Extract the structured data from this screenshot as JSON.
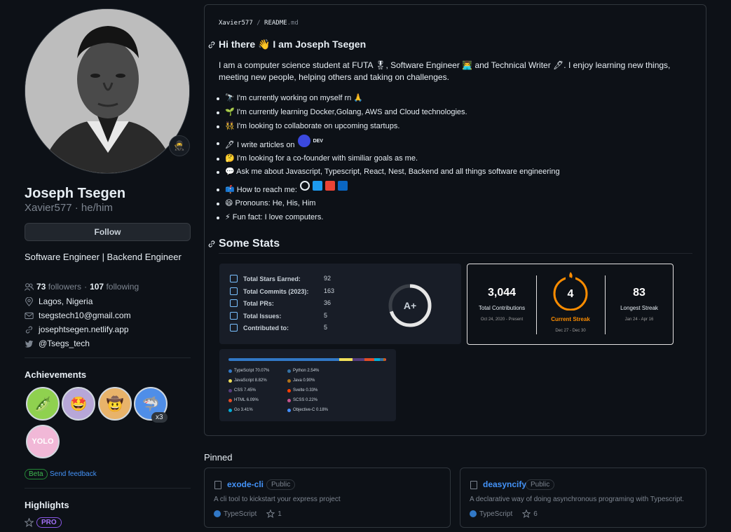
{
  "profile": {
    "name": "Joseph Tsegen",
    "login": "Xavier577",
    "pronouns": "he/him",
    "status_emoji": "🥷",
    "follow_label": "Follow",
    "bio": "Software Engineer | Backend Engineer",
    "followers_count": "73",
    "followers_label": "followers",
    "following_count": "107",
    "following_label": "following",
    "location": "Lagos, Nigeria",
    "email": "tsegstech10@gmail.com",
    "website": "josephtsegen.netlify.app",
    "twitter": "@Tsegs_tech"
  },
  "achievements": {
    "title": "Achievements",
    "badges": [
      {
        "name": "pair-extraordinaire",
        "emoji": "🫛",
        "color": "#8fd14f"
      },
      {
        "name": "starstruck",
        "emoji": "🤩",
        "color": "#b7a7d8"
      },
      {
        "name": "quickdraw",
        "emoji": "🤠",
        "color": "#e8b36a"
      },
      {
        "name": "pull-shark",
        "emoji": "🦈",
        "color": "#4f8ee8",
        "count": "x3"
      },
      {
        "name": "yolo",
        "emoji": "YOLO",
        "color": "#f1b8d7"
      }
    ],
    "beta": "Beta",
    "feedback": "Send feedback"
  },
  "highlights": {
    "title": "Highlights",
    "pro": "PRO"
  },
  "readme": {
    "owner": "Xavier577",
    "separator": "/",
    "file": "README",
    "ext": ".md",
    "heading": "Hi there 👋 I am Joseph Tsegen",
    "intro": "I am a computer science student at FUTA 🎖, Software Engineer 👨‍💻 and Technical Writer 🖋. I enjoy learning new things, meeting new people, helping others and taking on challenges.",
    "list": [
      "🔭 I'm currently working on myself rn 🙏",
      "🌱 I'm currently learning Docker,Golang, AWS and Cloud technologies.",
      "👯 I'm looking to collaborate on upcoming startups.",
      "🖋 I write articles on",
      "🤔 I'm looking for a co-founder with similiar goals as me.",
      "💬 Ask me about Javascript, Typescript, React, Nest, Backend and all things software engineering",
      "📫 How to reach me:",
      "😄 Pronouns: He, His, Him",
      "⚡ Fun fact: I love computers."
    ],
    "dev_label": "DEV",
    "stats_heading": "Some Stats"
  },
  "stats": {
    "rows": [
      {
        "label": "Total Stars Earned:",
        "value": "92"
      },
      {
        "label": "Total Commits (2023):",
        "value": "163"
      },
      {
        "label": "Total PRs:",
        "value": "36"
      },
      {
        "label": "Total Issues:",
        "value": "5"
      },
      {
        "label": "Contributed to:",
        "value": "5"
      }
    ],
    "grade": "A+",
    "grade_fraction": 0.7
  },
  "streak": {
    "total": {
      "value": "3,044",
      "label": "Total Contributions",
      "range": "Oct 24, 2020 - Present"
    },
    "current": {
      "value": "4",
      "label": "Current Streak",
      "range": "Dec 27 - Dec 30"
    },
    "longest": {
      "value": "83",
      "label": "Longest Streak",
      "range": "Jan 24 - Apr 16"
    },
    "accent": "#fb8c00"
  },
  "languages": [
    {
      "label": "TypeScript 70.07%",
      "percent": 70.07,
      "color": "#3178c6"
    },
    {
      "label": "JavaScript 8.82%",
      "percent": 8.82,
      "color": "#f1e05a"
    },
    {
      "label": "CSS 7.45%",
      "percent": 7.45,
      "color": "#563d7c"
    },
    {
      "label": "HTML 6.09%",
      "percent": 6.09,
      "color": "#e34c26"
    },
    {
      "label": "Go 3.41%",
      "percent": 3.41,
      "color": "#00add8"
    },
    {
      "label": "Python 2.54%",
      "percent": 2.54,
      "color": "#3572a5"
    },
    {
      "label": "Java 0.90%",
      "percent": 0.9,
      "color": "#b07219"
    },
    {
      "label": "Svelte 0.33%",
      "percent": 0.33,
      "color": "#ff3e00"
    },
    {
      "label": "SCSS 0.22%",
      "percent": 0.22,
      "color": "#c6538c"
    },
    {
      "label": "Objective-C 0.18%",
      "percent": 0.18,
      "color": "#438eff"
    }
  ],
  "pinned": {
    "title": "Pinned",
    "repos": [
      {
        "name": "exode-cli",
        "visibility": "Public",
        "description": "A cli tool to kickstart your express project",
        "language": "TypeScript",
        "stars": "1"
      },
      {
        "name": "deasyncify",
        "visibility": "Public",
        "description": "A declarative way of doing asynchronous programing with Typescript.",
        "language": "TypeScript",
        "stars": "6"
      }
    ]
  }
}
